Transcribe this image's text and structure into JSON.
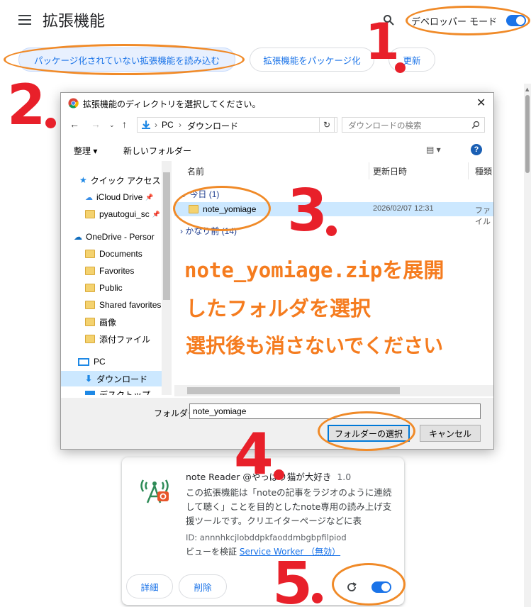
{
  "header": {
    "title": "拡張機能",
    "dev_mode_label": "デベロッパー モード"
  },
  "actions": {
    "load_unpacked": "パッケージ化されていない拡張機能を読み込む",
    "pack": "拡張機能をパッケージ化",
    "update": "更新"
  },
  "dialog": {
    "title": "拡張機能のディレクトリを選択してください。",
    "breadcrumb": [
      "PC",
      "ダウンロード"
    ],
    "search_placeholder": "ダウンロードの検索",
    "organize": "整理 ▾",
    "new_folder": "新しいフォルダー",
    "nav_items": [
      {
        "label": "クイック アクセス"
      },
      {
        "label": "iCloud Drive"
      },
      {
        "label": "pyautogui_sc"
      },
      {
        "label": "OneDrive - Persor"
      },
      {
        "label": "Documents"
      },
      {
        "label": "Favorites"
      },
      {
        "label": "Public"
      },
      {
        "label": "Shared favorites"
      },
      {
        "label": "画像"
      },
      {
        "label": "添付ファイル"
      },
      {
        "label": "PC"
      },
      {
        "label": "ダウンロード"
      },
      {
        "label": "デスクトップ"
      }
    ],
    "columns": {
      "name": "名前",
      "date": "更新日時",
      "type": "種類"
    },
    "group_today": "今日 (1)",
    "group_older": "かなり前 (14)",
    "file": {
      "name": "note_yomiage",
      "date": "2026/02/07 12:31",
      "type": "ファイル"
    },
    "folder_label": "フォルダー:",
    "folder_value": "note_yomiage",
    "select_button": "フォルダーの選択",
    "cancel_button": "キャンセル"
  },
  "extension": {
    "name": "note Reader @やっぱり猫が大好き",
    "version": "1.0",
    "description": "この拡張機能は「noteの記事をラジオのように連続して聴く」ことを目的としたnote専用の読み上げ支援ツールです。クリエイターページなどに表",
    "id": "ID: annnhkcjlobddpkfaoddmbgbpfilpiod",
    "views_label": "ビューを検証",
    "views_link": "Service Worker （無効）",
    "details_button": "詳細",
    "remove_button": "削除"
  },
  "annotations": {
    "step1": "1",
    "step2": "2",
    "step3": "3",
    "step4": "4",
    "step5": "5",
    "note_lines": [
      "note_yomiage.zipを展開",
      "したフォルダを選択",
      "選択後も消さないでください"
    ]
  },
  "colors": {
    "accent": "#1a73e8",
    "annotation_oval": "#f08a28",
    "annotation_number": "#e8202a",
    "annotation_text": "#f57c1f",
    "selection": "#cce8ff"
  }
}
